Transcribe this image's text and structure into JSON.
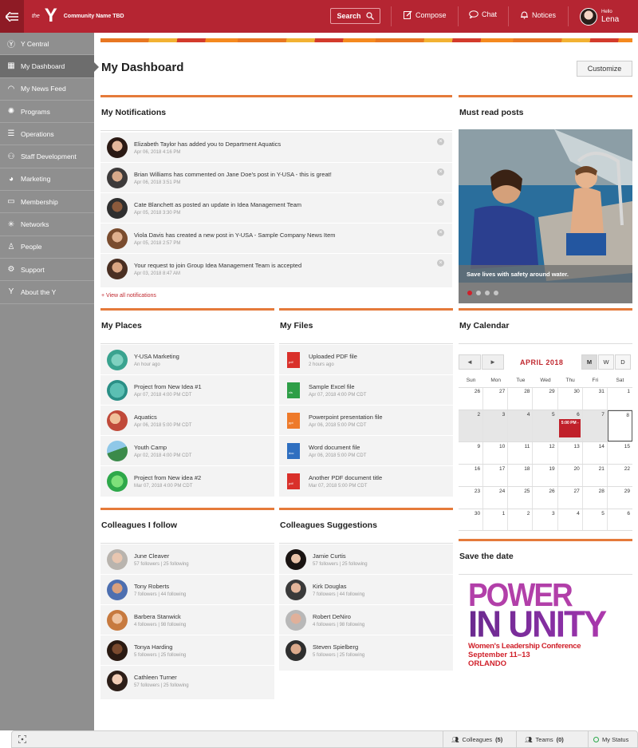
{
  "header": {
    "logo_the": "the",
    "logo_y": "Y",
    "community": "Community Name TBD",
    "search_label": "Search",
    "compose_label": "Compose",
    "chat_label": "Chat",
    "notices_label": "Notices",
    "hello": "Hello",
    "user_name": "Lena",
    "brand_color": "#b52532"
  },
  "sidebar": {
    "items": [
      {
        "label": "Y Central",
        "icon": "y-icon"
      },
      {
        "label": "My Dashboard",
        "icon": "grid-icon"
      },
      {
        "label": "My News Feed",
        "icon": "wifi-icon"
      },
      {
        "label": "Programs",
        "icon": "bulb-icon"
      },
      {
        "label": "Operations",
        "icon": "sliders-icon"
      },
      {
        "label": "Staff Development",
        "icon": "people-icon"
      },
      {
        "label": "Marketing",
        "icon": "megaphone-icon"
      },
      {
        "label": "Membership",
        "icon": "card-icon"
      },
      {
        "label": "Networks",
        "icon": "network-icon"
      },
      {
        "label": "People",
        "icon": "person-icon"
      },
      {
        "label": "Support",
        "icon": "gear-icon"
      },
      {
        "label": "About the Y",
        "icon": "y-small-icon"
      }
    ]
  },
  "main": {
    "title": "My Dashboard",
    "customize_label": "Customize"
  },
  "notifications": {
    "title": "My Notifications",
    "view_all": "+ View all notifications",
    "items": [
      {
        "text": "Elizabeth Taylor has added you to Department Aquatics",
        "time": "Apr 06, 2018 4:16 PM"
      },
      {
        "text": "Brian Williams has commented on Jane Doe's post in Y-USA - this is great!",
        "time": "Apr 06, 2018 3:51 PM"
      },
      {
        "text": "Cate Blanchett as posted an update in Idea Management Team",
        "time": "Apr 05, 2018 3:30 PM"
      },
      {
        "text": "Viola Davis has created a new post in Y-USA - Sample Company News Item",
        "time": "Apr 05, 2018 2:57 PM"
      },
      {
        "text": "Your request to join Group Idea Management Team is accepted",
        "time": "Apr 03, 2018 8:47 AM"
      }
    ]
  },
  "must_read": {
    "title": "Must read posts",
    "caption": "Save lives with safety around water."
  },
  "places": {
    "title": "My Places",
    "items": [
      {
        "name": "Y-USA Marketing",
        "meta": "An hour ago"
      },
      {
        "name": "Project from New Idea #1",
        "meta": "Apr 07, 2018 4:00 PM CDT"
      },
      {
        "name": "Aquatics",
        "meta": "Apr 06, 2018 5:00 PM CDT"
      },
      {
        "name": "Youth Camp",
        "meta": "Apr 02, 2018 4:00 PM CDT"
      },
      {
        "name": "Project from New idea #2",
        "meta": "Mar 07, 2018 4:00 PM CDT"
      }
    ]
  },
  "files": {
    "title": "My Files",
    "items": [
      {
        "name": "Uploaded PDF file",
        "meta": "2 hours ago",
        "ext": "pdf",
        "color": "#d9302a"
      },
      {
        "name": "Sample Excel file",
        "meta": "Apr 07, 2018 4:00 PM CDT",
        "ext": "xls",
        "color": "#2e9e47"
      },
      {
        "name": "Powerpoint presentation file",
        "meta": "Apr 06, 2018 5:00 PM CDT",
        "ext": "ppt",
        "color": "#ee7a2a"
      },
      {
        "name": "Word document file",
        "meta": "Apr 06, 2018 5:00 PM CDT",
        "ext": "doc",
        "color": "#2f6fc0"
      },
      {
        "name": "Another PDF document title",
        "meta": "Mar 07, 2018 5:00 PM CDT",
        "ext": "pdf",
        "color": "#d9302a"
      }
    ]
  },
  "calendar": {
    "title": "My Calendar",
    "prev": "◄",
    "next": "►",
    "month": "APRIL 2018",
    "views": [
      "M",
      "W",
      "D"
    ],
    "dow": [
      "Sun",
      "Mon",
      "Tue",
      "Wed",
      "Thu",
      "Fri",
      "Sat"
    ],
    "weeks": [
      [
        "26",
        "27",
        "28",
        "29",
        "30",
        "31",
        "1"
      ],
      [
        "2",
        "3",
        "4",
        "5",
        "6",
        "7",
        "8"
      ],
      [
        "9",
        "10",
        "11",
        "12",
        "13",
        "14",
        "15"
      ],
      [
        "16",
        "17",
        "18",
        "19",
        "20",
        "21",
        "22"
      ],
      [
        "23",
        "24",
        "25",
        "26",
        "27",
        "28",
        "29"
      ],
      [
        "30",
        "1",
        "2",
        "3",
        "4",
        "5",
        "6"
      ]
    ],
    "event_text": "5:00 PM -"
  },
  "colleagues_follow": {
    "title": "Colleagues I follow",
    "items": [
      {
        "name": "June Cleaver",
        "meta": "57 followers | 25 following"
      },
      {
        "name": "Tony Roberts",
        "meta": "7 followers | 44 following"
      },
      {
        "name": "Barbera Stanwick",
        "meta": "4 followers | 98 following"
      },
      {
        "name": "Tonya Harding",
        "meta": "5 followers | 25 following"
      },
      {
        "name": "Cathleen Turner",
        "meta": "57 followers | 25 following"
      }
    ]
  },
  "colleagues_suggest": {
    "title": "Colleagues Suggestions",
    "items": [
      {
        "name": "Jamie Curtis",
        "meta": "57 followers | 25 following"
      },
      {
        "name": "Kirk Douglas",
        "meta": "7 followers | 44 following"
      },
      {
        "name": "Robert DeNiro",
        "meta": "4 followers | 98 following"
      },
      {
        "name": "Steven Spielberg",
        "meta": "5 followers | 25 following"
      }
    ]
  },
  "save_date": {
    "title": "Save the date",
    "line1": "POWER",
    "line2": "IN UNITY",
    "line3": "Women's Leadership Conference",
    "line4": "September 11–13",
    "line5": "ORLANDO"
  },
  "bottombar": {
    "colleagues_label": "Colleagues",
    "colleagues_count": "(5)",
    "teams_label": "Teams",
    "teams_count": "(0)",
    "status_label": "My Status"
  }
}
